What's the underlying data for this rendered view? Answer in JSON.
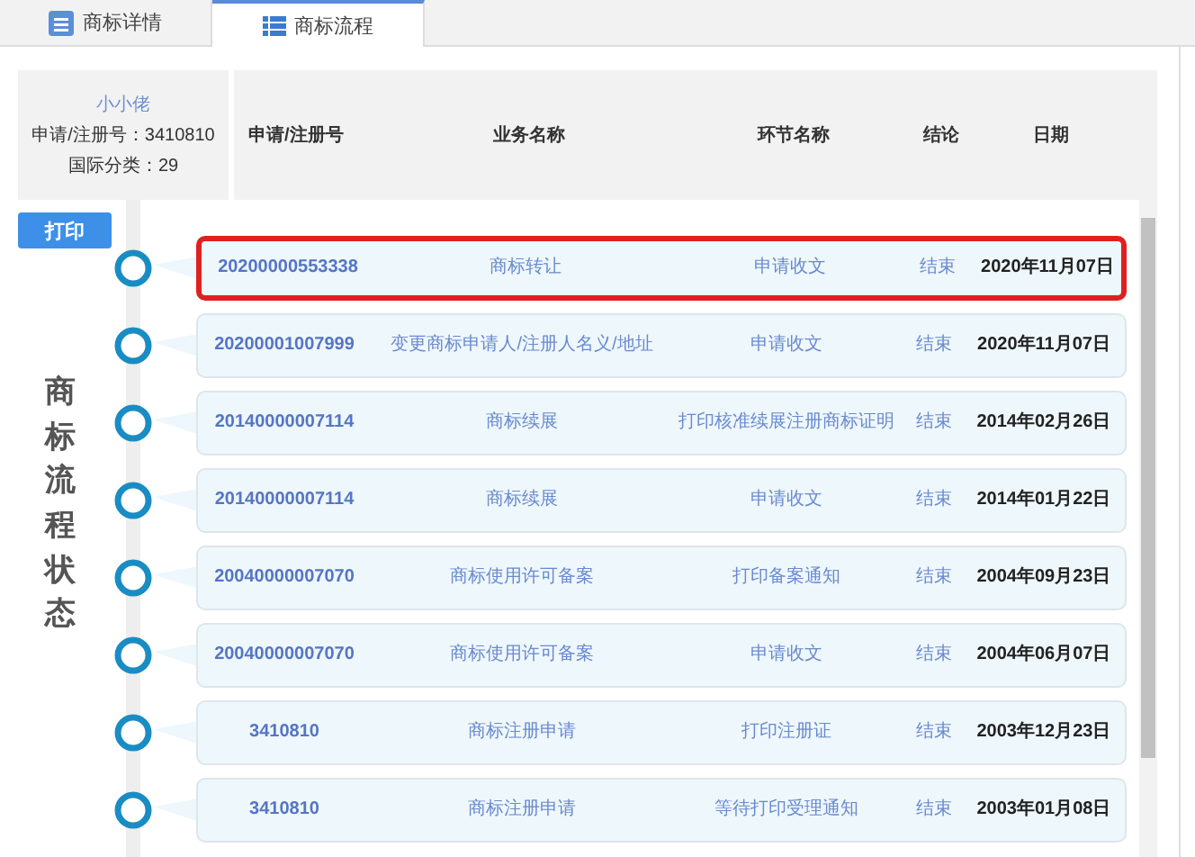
{
  "tabs": [
    {
      "label": "商标详情",
      "selected": false
    },
    {
      "label": "商标流程",
      "selected": true
    }
  ],
  "summary": {
    "name": "小小佬",
    "reg_no": "申请/注册号：3410810",
    "class": "国际分类：29"
  },
  "columns": [
    "申请/注册号",
    "业务名称",
    "环节名称",
    "结论",
    "日期"
  ],
  "print_button": "打印",
  "side_title": "商标流程状态",
  "rows": [
    {
      "number": "20200000553338",
      "business": "商标转让",
      "step": "申请收文",
      "result": "结束",
      "date": "2020年11月07日",
      "highlighted": true
    },
    {
      "number": "20200001007999",
      "business": "变更商标申请人/注册人名义/地址",
      "step": "申请收文",
      "result": "结束",
      "date": "2020年11月07日",
      "highlighted": false
    },
    {
      "number": "20140000007114",
      "business": "商标续展",
      "step": "打印核准续展注册商标证明",
      "result": "结束",
      "date": "2014年02月26日",
      "highlighted": false
    },
    {
      "number": "20140000007114",
      "business": "商标续展",
      "step": "申请收文",
      "result": "结束",
      "date": "2014年01月22日",
      "highlighted": false
    },
    {
      "number": "20040000007070",
      "business": "商标使用许可备案",
      "step": "打印备案通知",
      "result": "结束",
      "date": "2004年09月23日",
      "highlighted": false
    },
    {
      "number": "20040000007070",
      "business": "商标使用许可备案",
      "step": "申请收文",
      "result": "结束",
      "date": "2004年06月07日",
      "highlighted": false
    },
    {
      "number": "3410810",
      "business": "商标注册申请",
      "step": "打印注册证",
      "result": "结束",
      "date": "2003年12月23日",
      "highlighted": false
    },
    {
      "number": "3410810",
      "business": "商标注册申请",
      "step": "等待打印受理通知",
      "result": "结束",
      "date": "2003年01月08日",
      "highlighted": false
    }
  ]
}
